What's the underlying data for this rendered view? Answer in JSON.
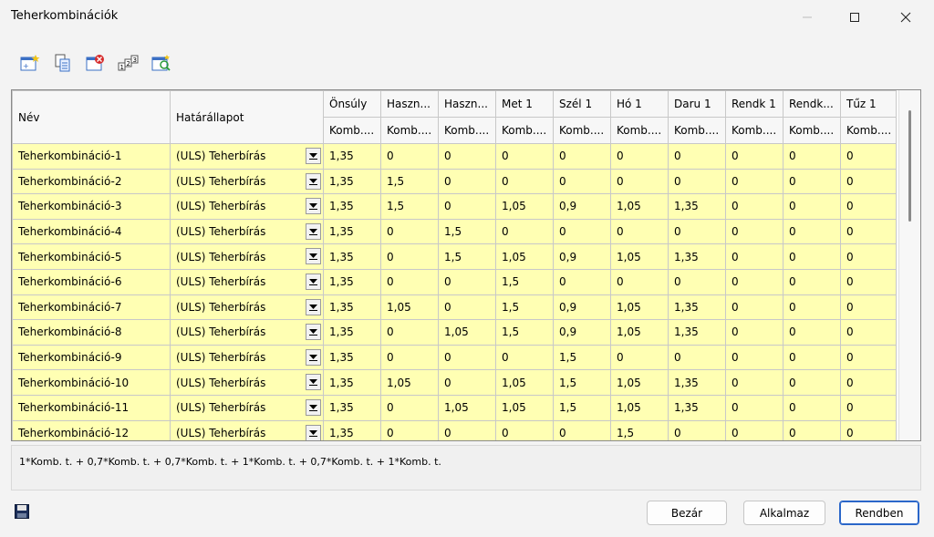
{
  "window": {
    "title": "Teherkombinációk"
  },
  "grid": {
    "columns": [
      {
        "label": "Név",
        "sub": ""
      },
      {
        "label": "Határállapot",
        "sub": ""
      },
      {
        "label": "Önsúly",
        "sub": "Komb...."
      },
      {
        "label": "Haszn...",
        "sub": "Komb...."
      },
      {
        "label": "Haszn...",
        "sub": "Komb...."
      },
      {
        "label": "Met 1",
        "sub": "Komb...."
      },
      {
        "label": "Szél 1",
        "sub": "Komb...."
      },
      {
        "label": "Hó 1",
        "sub": "Komb...."
      },
      {
        "label": "Daru 1",
        "sub": "Komb...."
      },
      {
        "label": "Rendk 1",
        "sub": "Komb...."
      },
      {
        "label": "Rendk...",
        "sub": "Komb...."
      },
      {
        "label": "Tűz 1",
        "sub": "Komb...."
      }
    ],
    "rows": [
      {
        "name": "Teherkombináció-1",
        "limit": "(ULS) Teherbírás",
        "values": [
          "1,35",
          "0",
          "0",
          "0",
          "0",
          "0",
          "0",
          "0",
          "0",
          "0"
        ]
      },
      {
        "name": "Teherkombináció-2",
        "limit": "(ULS) Teherbírás",
        "values": [
          "1,35",
          "1,5",
          "0",
          "0",
          "0",
          "0",
          "0",
          "0",
          "0",
          "0"
        ]
      },
      {
        "name": "Teherkombináció-3",
        "limit": "(ULS) Teherbírás",
        "values": [
          "1,35",
          "1,5",
          "0",
          "1,05",
          "0,9",
          "1,05",
          "1,35",
          "0",
          "0",
          "0"
        ]
      },
      {
        "name": "Teherkombináció-4",
        "limit": "(ULS) Teherbírás",
        "values": [
          "1,35",
          "0",
          "1,5",
          "0",
          "0",
          "0",
          "0",
          "0",
          "0",
          "0"
        ]
      },
      {
        "name": "Teherkombináció-5",
        "limit": "(ULS) Teherbírás",
        "values": [
          "1,35",
          "0",
          "1,5",
          "1,05",
          "0,9",
          "1,05",
          "1,35",
          "0",
          "0",
          "0"
        ]
      },
      {
        "name": "Teherkombináció-6",
        "limit": "(ULS) Teherbírás",
        "values": [
          "1,35",
          "0",
          "0",
          "1,5",
          "0",
          "0",
          "0",
          "0",
          "0",
          "0"
        ]
      },
      {
        "name": "Teherkombináció-7",
        "limit": "(ULS) Teherbírás",
        "values": [
          "1,35",
          "1,05",
          "0",
          "1,5",
          "0,9",
          "1,05",
          "1,35",
          "0",
          "0",
          "0"
        ]
      },
      {
        "name": "Teherkombináció-8",
        "limit": "(ULS) Teherbírás",
        "values": [
          "1,35",
          "0",
          "1,05",
          "1,5",
          "0,9",
          "1,05",
          "1,35",
          "0",
          "0",
          "0"
        ]
      },
      {
        "name": "Teherkombináció-9",
        "limit": "(ULS) Teherbírás",
        "values": [
          "1,35",
          "0",
          "0",
          "0",
          "1,5",
          "0",
          "0",
          "0",
          "0",
          "0"
        ]
      },
      {
        "name": "Teherkombináció-10",
        "limit": "(ULS) Teherbírás",
        "values": [
          "1,35",
          "1,05",
          "0",
          "1,05",
          "1,5",
          "1,05",
          "1,35",
          "0",
          "0",
          "0"
        ]
      },
      {
        "name": "Teherkombináció-11",
        "limit": "(ULS) Teherbírás",
        "values": [
          "1,35",
          "0",
          "1,05",
          "1,05",
          "1,5",
          "1,05",
          "1,35",
          "0",
          "0",
          "0"
        ]
      },
      {
        "name": "Teherkombináció-12",
        "limit": "(ULS) Teherbírás",
        "values": [
          "1,35",
          "0",
          "0",
          "0",
          "0",
          "1,5",
          "0",
          "0",
          "0",
          "0"
        ]
      }
    ]
  },
  "formula": "1*Komb. t. + 0,7*Komb. t. + 0,7*Komb. t. + 1*Komb. t. + 0,7*Komb. t. + 1*Komb. t.",
  "buttons": {
    "close": "Bezár",
    "apply": "Alkalmaz",
    "ok": "Rendben"
  },
  "toolbar_icons": [
    "new-combination-icon",
    "copy-icon",
    "delete-icon",
    "numbering-icon",
    "generate-icon"
  ],
  "colors": {
    "cell_bg": "#ffffb3",
    "header_bg": "#f7f7f7",
    "accent": "#2a66c9"
  }
}
